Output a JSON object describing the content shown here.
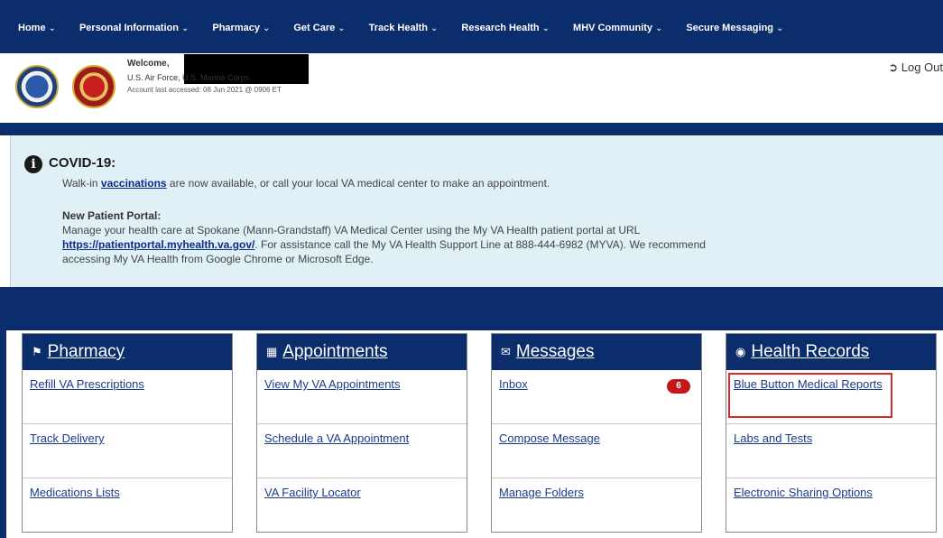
{
  "nav": {
    "items": [
      {
        "label": "Home"
      },
      {
        "label": "Personal Information"
      },
      {
        "label": "Pharmacy"
      },
      {
        "label": "Get Care"
      },
      {
        "label": "Track Health"
      },
      {
        "label": "Research Health"
      },
      {
        "label": "MHV Community"
      },
      {
        "label": "Secure Messaging"
      }
    ]
  },
  "header": {
    "welcome": "Welcome,",
    "branch": "U.S. Air Force, U.S. Marine Corps",
    "accessed": "Account last accessed: 08 Jun 2021 @ 0906 ET",
    "logout": "Log Out"
  },
  "alert": {
    "title": "COVID-19:",
    "line1_pre": "Walk-in ",
    "line1_link": "vaccinations",
    "line1_post": " are now available, or call your local VA medical center to make an appointment.",
    "np_title": "New Patient Portal:",
    "np_line1": "Manage your health care at Spokane (Mann-Grandstaff) VA Medical Center using the My VA Health patient portal at URL",
    "np_link": "https://patientportal.myhealth.va.gov/",
    "np_line2_post": ". For assistance call the My VA Health Support Line at 888-444-6982 (MYVA). We recommend",
    "np_line3": "accessing My VA Health from Google Chrome or Microsoft Edge."
  },
  "cards": {
    "pharmacy": {
      "title": "Pharmacy",
      "icon": "pharmacy-icon",
      "items": [
        "Refill VA Prescriptions",
        "Track Delivery",
        "Medications Lists"
      ]
    },
    "appointments": {
      "title": "Appointments",
      "icon": "calendar-icon",
      "items": [
        "View My VA Appointments",
        "Schedule a VA Appointment",
        "VA Facility Locator"
      ]
    },
    "messages": {
      "title": "Messages",
      "icon": "messages-icon",
      "items": [
        "Inbox",
        "Compose Message",
        "Manage Folders"
      ],
      "inbox_count": "6"
    },
    "records": {
      "title": "Health Records",
      "icon": "records-icon",
      "items": [
        "Blue Button Medical Reports",
        "Labs and Tests",
        "Electronic Sharing Options"
      ]
    }
  },
  "colors": {
    "nav_bg": "#0b2d6b",
    "alert_bg": "#dff0f7",
    "link": "#1a3a8a",
    "highlight": "#d42a2a",
    "badge": "#c21818"
  }
}
